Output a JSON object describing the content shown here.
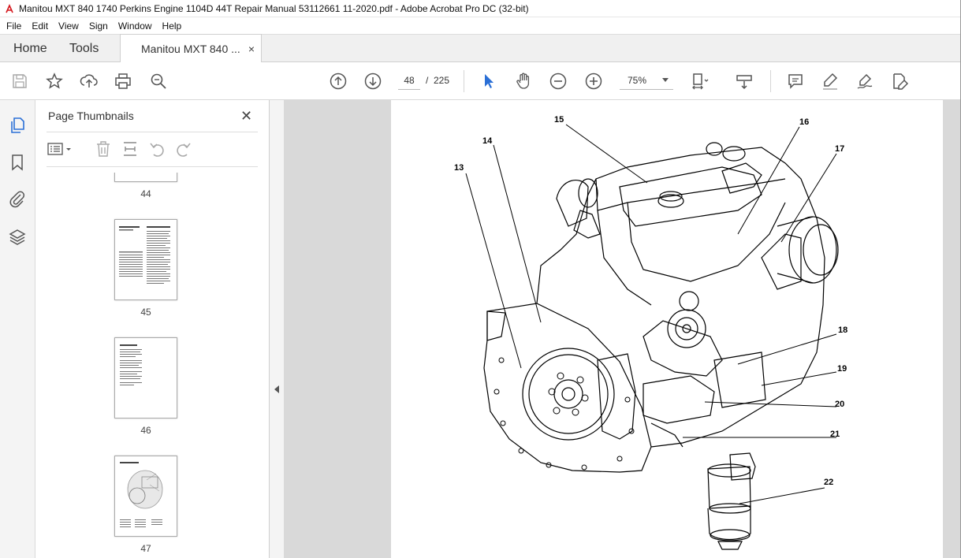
{
  "window": {
    "title": "Manitou MXT 840 1740 Perkins Engine 1104D 44T Repair Manual 53112661 11-2020.pdf - Adobe Acrobat Pro DC (32-bit)",
    "app_icon": "acrobat-icon"
  },
  "menu": [
    "File",
    "Edit",
    "View",
    "Sign",
    "Window",
    "Help"
  ],
  "tabs": {
    "home": "Home",
    "tools": "Tools",
    "document": "Manitou MXT 840 ...",
    "close": "×"
  },
  "toolbar": {
    "page_current": "48",
    "page_sep": "/",
    "page_total": "225",
    "zoom": "75%",
    "icons": [
      "save-icon",
      "star-icon",
      "upload-icon",
      "print-icon",
      "zoom-search-icon",
      "page-up-icon",
      "page-down-icon",
      "select-cursor-icon",
      "hand-icon",
      "zoom-out-icon",
      "zoom-in-icon",
      "fit-page-icon",
      "scroll-mode-icon",
      "comment-icon",
      "highlight-icon",
      "sign-icon",
      "edit-pdf-icon"
    ]
  },
  "thumbnails_panel": {
    "title": "Page Thumbnails",
    "close": "✕",
    "pages": [
      {
        "number": "44"
      },
      {
        "number": "45"
      },
      {
        "number": "46"
      },
      {
        "number": "47"
      }
    ]
  },
  "diagram": {
    "callouts": [
      "13",
      "14",
      "15",
      "16",
      "17",
      "18",
      "19",
      "20",
      "21",
      "22"
    ]
  },
  "colors": {
    "accent_blue": "#2a6fd6",
    "acrobat_red": "#d4151c",
    "viewer_bg": "#d9d9d9"
  }
}
